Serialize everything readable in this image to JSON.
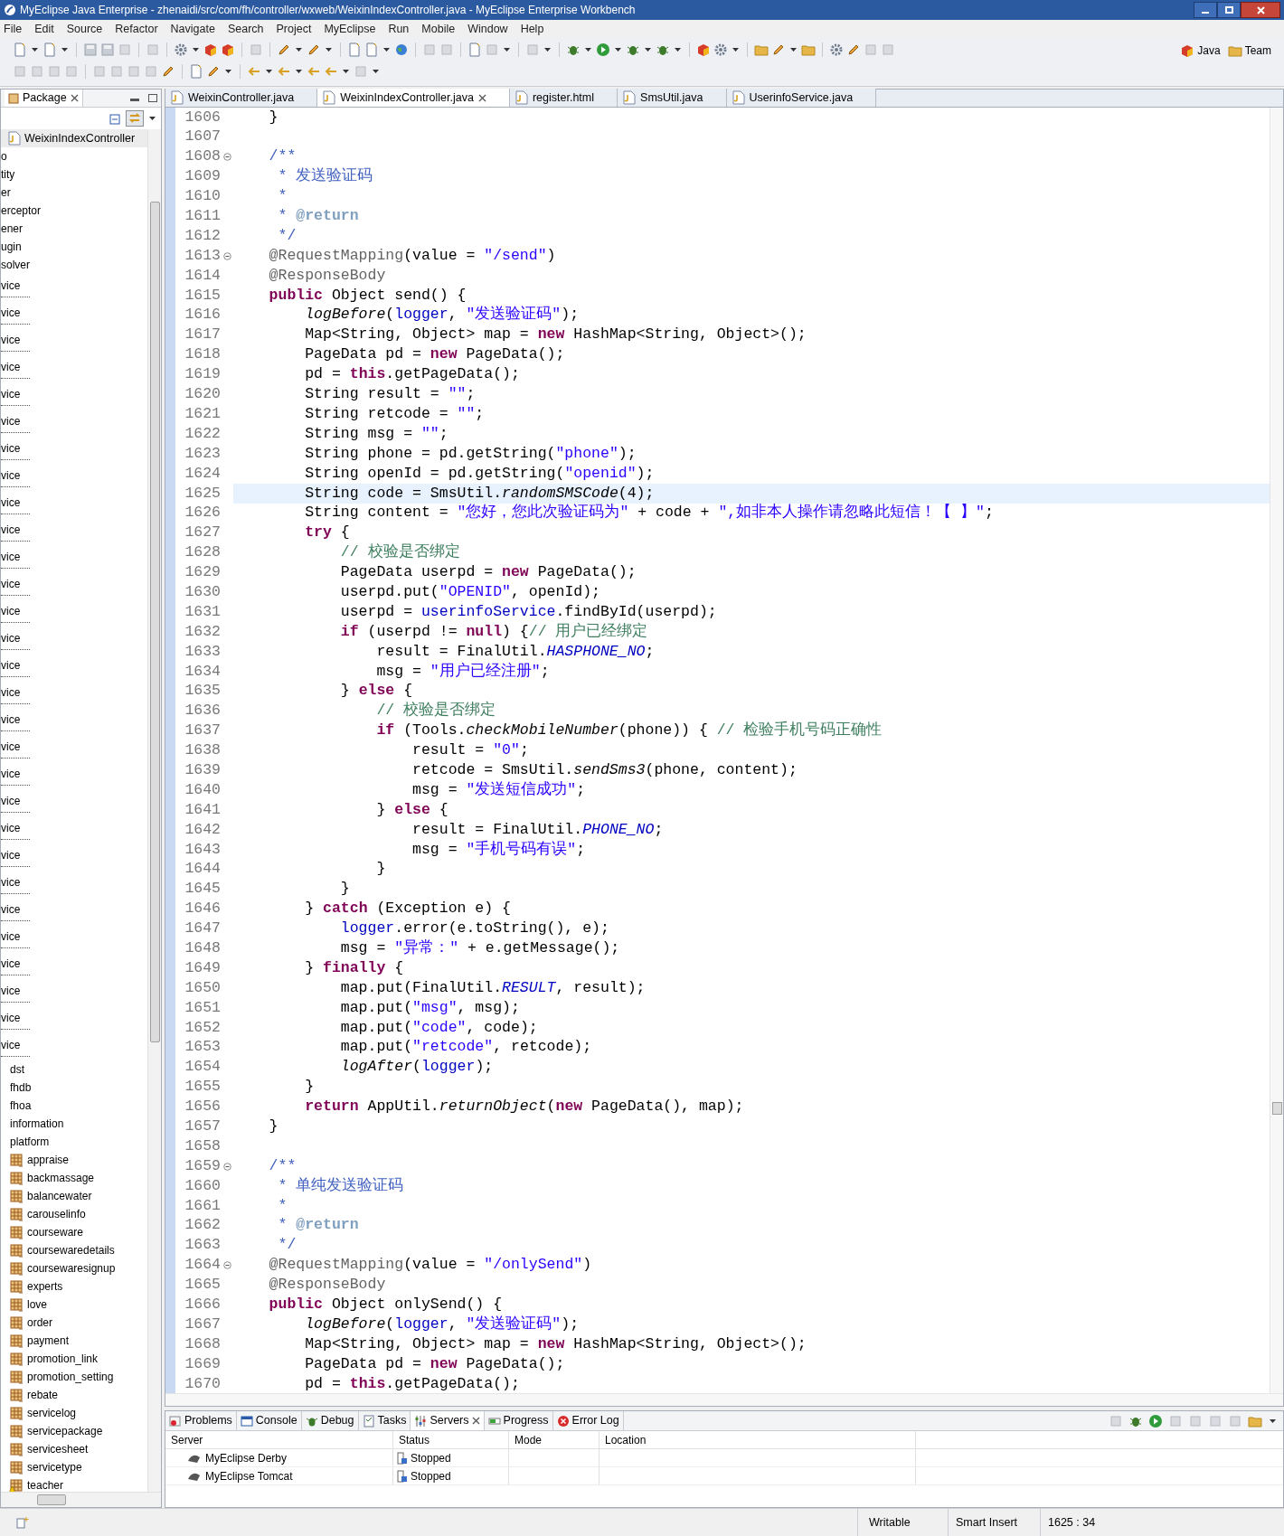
{
  "window": {
    "title": "MyEclipse Java Enterprise - zhenaidi/src/com/fh/controller/wxweb/WeixinIndexController.java - MyEclipse Enterprise Workbench"
  },
  "menu": [
    "File",
    "Edit",
    "Source",
    "Refactor",
    "Navigate",
    "Search",
    "Project",
    "MyEclipse",
    "Run",
    "Mobile",
    "Window",
    "Help"
  ],
  "perspectives": [
    "Java",
    "Team"
  ],
  "sidebar": {
    "tab": "Package",
    "breadcrumb": "WeixinIndexController",
    "items": [
      {
        "label": "o",
        "kind": "cut"
      },
      {
        "label": "tity",
        "kind": "cut"
      },
      {
        "label": "er",
        "kind": "cut"
      },
      {
        "label": "erceptor",
        "kind": "cut"
      },
      {
        "label": "ener",
        "kind": "cut"
      },
      {
        "label": "ugin",
        "kind": "cut"
      },
      {
        "label": "solver",
        "kind": "cut"
      },
      {
        "label": "vice",
        "kind": "dotted"
      },
      {
        "label": "vice",
        "kind": "dotted"
      },
      {
        "label": "vice",
        "kind": "dotted"
      },
      {
        "label": "vice",
        "kind": "dotted"
      },
      {
        "label": "vice",
        "kind": "dotted"
      },
      {
        "label": "vice",
        "kind": "dotted"
      },
      {
        "label": "vice",
        "kind": "dotted"
      },
      {
        "label": "vice",
        "kind": "dotted"
      },
      {
        "label": "vice",
        "kind": "dotted"
      },
      {
        "label": "vice",
        "kind": "dotted"
      },
      {
        "label": "vice",
        "kind": "dotted"
      },
      {
        "label": "vice",
        "kind": "dotted"
      },
      {
        "label": "vice",
        "kind": "dotted"
      },
      {
        "label": "vice",
        "kind": "dotted"
      },
      {
        "label": "vice",
        "kind": "dotted"
      },
      {
        "label": "vice",
        "kind": "dotted"
      },
      {
        "label": "vice",
        "kind": "dotted"
      },
      {
        "label": "vice",
        "kind": "dotted"
      },
      {
        "label": "vice",
        "kind": "dotted"
      },
      {
        "label": "vice",
        "kind": "dotted"
      },
      {
        "label": "vice",
        "kind": "dotted"
      },
      {
        "label": "vice",
        "kind": "dotted"
      },
      {
        "label": "vice",
        "kind": "dotted"
      },
      {
        "label": "vice",
        "kind": "dotted"
      },
      {
        "label": "vice",
        "kind": "dotted"
      },
      {
        "label": "vice",
        "kind": "dotted"
      },
      {
        "label": "vice",
        "kind": "dotted"
      },
      {
        "label": "vice",
        "kind": "dotted"
      },
      {
        "label": "vice",
        "kind": "dotted"
      },
      {
        "label": "dst",
        "kind": "plain"
      },
      {
        "label": "fhdb",
        "kind": "plain"
      },
      {
        "label": "fhoa",
        "kind": "plain"
      },
      {
        "label": "information",
        "kind": "plain"
      },
      {
        "label": "platform",
        "kind": "plain"
      },
      {
        "label": "appraise",
        "kind": "package",
        "warning": false
      },
      {
        "label": "backmassage",
        "kind": "package",
        "warning": false
      },
      {
        "label": "balancewater",
        "kind": "package",
        "warning": false
      },
      {
        "label": "carouselinfo",
        "kind": "package",
        "warning": false
      },
      {
        "label": "courseware",
        "kind": "package",
        "warning": false
      },
      {
        "label": "coursewaredetails",
        "kind": "package",
        "warning": false
      },
      {
        "label": "coursewaresignup",
        "kind": "package",
        "warning": false
      },
      {
        "label": "experts",
        "kind": "package",
        "warning": false
      },
      {
        "label": "love",
        "kind": "package",
        "warning": false
      },
      {
        "label": "order",
        "kind": "package",
        "warning": false
      },
      {
        "label": "payment",
        "kind": "package",
        "warning": false
      },
      {
        "label": "promotion_link",
        "kind": "package",
        "warning": false
      },
      {
        "label": "promotion_setting",
        "kind": "package",
        "warning": false
      },
      {
        "label": "rebate",
        "kind": "package",
        "warning": false
      },
      {
        "label": "servicelog",
        "kind": "package",
        "warning": false
      },
      {
        "label": "servicepackage",
        "kind": "package",
        "warning": false
      },
      {
        "label": "servicesheet",
        "kind": "package",
        "warning": false
      },
      {
        "label": "servicetype",
        "kind": "package",
        "warning": false
      },
      {
        "label": "teacher",
        "kind": "package",
        "warning": true
      }
    ]
  },
  "editor_tabs": [
    {
      "label": "WeixinController.java",
      "selected": false
    },
    {
      "label": "WeixinIndexController.java",
      "selected": true
    },
    {
      "label": "register.html",
      "selected": false
    },
    {
      "label": "SmsUtil.java",
      "selected": false
    },
    {
      "label": "UserinfoService.java",
      "selected": false
    }
  ],
  "code": [
    {
      "n": "1606",
      "t": [
        {
          "kind": "p",
          "text": "    }"
        }
      ]
    },
    {
      "n": "1607"
    },
    {
      "n": "1608",
      "fold": true,
      "t": [
        {
          "kind": "doc",
          "text": "    /**"
        }
      ]
    },
    {
      "n": "1609",
      "t": [
        {
          "kind": "doc",
          "text": "     * 发送验证码"
        }
      ]
    },
    {
      "n": "1610",
      "t": [
        {
          "kind": "doc",
          "text": "     *"
        }
      ]
    },
    {
      "n": "1611",
      "t": [
        {
          "kind": "doc",
          "text": "     * "
        },
        {
          "kind": "tag",
          "text": "@return"
        }
      ]
    },
    {
      "n": "1612",
      "t": [
        {
          "kind": "doc",
          "text": "     */"
        }
      ]
    },
    {
      "n": "1613",
      "fold": true,
      "t": [
        {
          "kind": "anno",
          "text": "    @RequestMapping"
        },
        {
          "kind": "p",
          "text": "(value = "
        },
        {
          "kind": "str",
          "text": "\"/send\""
        },
        {
          "kind": "p",
          "text": ")"
        }
      ]
    },
    {
      "n": "1614",
      "t": [
        {
          "kind": "anno",
          "text": "    @ResponseBody"
        }
      ]
    },
    {
      "n": "1615",
      "t": [
        {
          "kind": "kw",
          "text": "    public"
        },
        {
          "kind": "p",
          "text": " Object send() {"
        }
      ]
    },
    {
      "n": "1616",
      "t": [
        {
          "kind": "it",
          "text": "        logBefore"
        },
        {
          "kind": "p",
          "text": "("
        },
        {
          "kind": "fld",
          "text": "logger"
        },
        {
          "kind": "p",
          "text": ", "
        },
        {
          "kind": "str",
          "text": "\"发送验证码\""
        },
        {
          "kind": "p",
          "text": ");"
        }
      ]
    },
    {
      "n": "1617",
      "t": [
        {
          "kind": "p",
          "text": "        Map<String, Object> map = "
        },
        {
          "kind": "kw",
          "text": "new"
        },
        {
          "kind": "p",
          "text": " HashMap<String, Object>();"
        }
      ]
    },
    {
      "n": "1618",
      "t": [
        {
          "kind": "p",
          "text": "        PageData pd = "
        },
        {
          "kind": "kw",
          "text": "new"
        },
        {
          "kind": "p",
          "text": " PageData();"
        }
      ]
    },
    {
      "n": "1619",
      "t": [
        {
          "kind": "p",
          "text": "        pd = "
        },
        {
          "kind": "kw",
          "text": "this"
        },
        {
          "kind": "p",
          "text": ".getPageData();"
        }
      ]
    },
    {
      "n": "1620",
      "t": [
        {
          "kind": "p",
          "text": "        String result = "
        },
        {
          "kind": "str",
          "text": "\"\""
        },
        {
          "kind": "p",
          "text": ";"
        }
      ]
    },
    {
      "n": "1621",
      "t": [
        {
          "kind": "p",
          "text": "        String retcode = "
        },
        {
          "kind": "str",
          "text": "\"\""
        },
        {
          "kind": "p",
          "text": ";"
        }
      ]
    },
    {
      "n": "1622",
      "t": [
        {
          "kind": "p",
          "text": "        String msg = "
        },
        {
          "kind": "str",
          "text": "\"\""
        },
        {
          "kind": "p",
          "text": ";"
        }
      ]
    },
    {
      "n": "1623",
      "t": [
        {
          "kind": "p",
          "text": "        String phone = pd.getString("
        },
        {
          "kind": "str",
          "text": "\"phone\""
        },
        {
          "kind": "p",
          "text": ");"
        }
      ]
    },
    {
      "n": "1624",
      "t": [
        {
          "kind": "p",
          "text": "        String openId = pd.getString("
        },
        {
          "kind": "str",
          "text": "\"openid\""
        },
        {
          "kind": "p",
          "text": ");"
        }
      ]
    },
    {
      "n": "1625",
      "current": true,
      "t": [
        {
          "kind": "p",
          "text": "        String code = SmsUtil."
        },
        {
          "kind": "it",
          "text": "randomSMSCode"
        },
        {
          "kind": "p",
          "text": "(4);"
        }
      ]
    },
    {
      "n": "1626",
      "t": [
        {
          "kind": "p",
          "text": "        String content = "
        },
        {
          "kind": "str",
          "text": "\"您好，您此次验证码为\""
        },
        {
          "kind": "p",
          "text": " + code + "
        },
        {
          "kind": "str",
          "text": "\",如非本人操作请忽略此短信！【 】\""
        },
        {
          "kind": "p",
          "text": ";"
        }
      ]
    },
    {
      "n": "1627",
      "t": [
        {
          "kind": "kw",
          "text": "        try"
        },
        {
          "kind": "p",
          "text": " {"
        }
      ]
    },
    {
      "n": "1628",
      "t": [
        {
          "kind": "cmt",
          "text": "            // 校验是否绑定"
        }
      ]
    },
    {
      "n": "1629",
      "t": [
        {
          "kind": "p",
          "text": "            PageData userpd = "
        },
        {
          "kind": "kw",
          "text": "new"
        },
        {
          "kind": "p",
          "text": " PageData();"
        }
      ]
    },
    {
      "n": "1630",
      "t": [
        {
          "kind": "p",
          "text": "            userpd.put("
        },
        {
          "kind": "str",
          "text": "\"OPENID\""
        },
        {
          "kind": "p",
          "text": ", openId);"
        }
      ]
    },
    {
      "n": "1631",
      "t": [
        {
          "kind": "p",
          "text": "            userpd = "
        },
        {
          "kind": "fld",
          "text": "userinfoService"
        },
        {
          "kind": "p",
          "text": ".findById(userpd);"
        }
      ]
    },
    {
      "n": "1632",
      "t": [
        {
          "kind": "kw",
          "text": "            if"
        },
        {
          "kind": "p",
          "text": " (userpd != "
        },
        {
          "kind": "kw",
          "text": "null"
        },
        {
          "kind": "p",
          "text": ") {"
        },
        {
          "kind": "cmt",
          "text": "// 用户已经绑定"
        }
      ]
    },
    {
      "n": "1633",
      "t": [
        {
          "kind": "p",
          "text": "                result = FinalUtil."
        },
        {
          "kind": "const",
          "text": "HASPHONE_NO"
        },
        {
          "kind": "p",
          "text": ";"
        }
      ]
    },
    {
      "n": "1634",
      "t": [
        {
          "kind": "p",
          "text": "                msg = "
        },
        {
          "kind": "str",
          "text": "\"用户已经注册\""
        },
        {
          "kind": "p",
          "text": ";"
        }
      ]
    },
    {
      "n": "1635",
      "t": [
        {
          "kind": "p",
          "text": "            } "
        },
        {
          "kind": "kw",
          "text": "else"
        },
        {
          "kind": "p",
          "text": " {"
        }
      ]
    },
    {
      "n": "1636",
      "t": [
        {
          "kind": "cmt",
          "text": "                // 校验是否绑定"
        }
      ]
    },
    {
      "n": "1637",
      "t": [
        {
          "kind": "kw",
          "text": "                if"
        },
        {
          "kind": "p",
          "text": " (Tools."
        },
        {
          "kind": "it",
          "text": "checkMobileNumber"
        },
        {
          "kind": "p",
          "text": "(phone)) { "
        },
        {
          "kind": "cmt",
          "text": "// 检验手机号码正确性"
        }
      ]
    },
    {
      "n": "1638",
      "t": [
        {
          "kind": "p",
          "text": "                    result = "
        },
        {
          "kind": "str",
          "text": "\"0\""
        },
        {
          "kind": "p",
          "text": ";"
        }
      ]
    },
    {
      "n": "1639",
      "t": [
        {
          "kind": "p",
          "text": "                    retcode = SmsUtil."
        },
        {
          "kind": "it",
          "text": "sendSms3"
        },
        {
          "kind": "p",
          "text": "(phone, content);"
        }
      ]
    },
    {
      "n": "1640",
      "t": [
        {
          "kind": "p",
          "text": "                    msg = "
        },
        {
          "kind": "str",
          "text": "\"发送短信成功\""
        },
        {
          "kind": "p",
          "text": ";"
        }
      ]
    },
    {
      "n": "1641",
      "t": [
        {
          "kind": "p",
          "text": "                } "
        },
        {
          "kind": "kw",
          "text": "else"
        },
        {
          "kind": "p",
          "text": " {"
        }
      ]
    },
    {
      "n": "1642",
      "t": [
        {
          "kind": "p",
          "text": "                    result = FinalUtil."
        },
        {
          "kind": "const",
          "text": "PHONE_NO"
        },
        {
          "kind": "p",
          "text": ";"
        }
      ]
    },
    {
      "n": "1643",
      "t": [
        {
          "kind": "p",
          "text": "                    msg = "
        },
        {
          "kind": "str",
          "text": "\"手机号码有误\""
        },
        {
          "kind": "p",
          "text": ";"
        }
      ]
    },
    {
      "n": "1644",
      "t": [
        {
          "kind": "p",
          "text": "                }"
        }
      ]
    },
    {
      "n": "1645",
      "t": [
        {
          "kind": "p",
          "text": "            }"
        }
      ]
    },
    {
      "n": "1646",
      "t": [
        {
          "kind": "p",
          "text": "        } "
        },
        {
          "kind": "kw",
          "text": "catch"
        },
        {
          "kind": "p",
          "text": " (Exception e) {"
        }
      ]
    },
    {
      "n": "1647",
      "t": [
        {
          "kind": "fld",
          "text": "            logger"
        },
        {
          "kind": "p",
          "text": ".error(e.toString(), e);"
        }
      ]
    },
    {
      "n": "1648",
      "t": [
        {
          "kind": "p",
          "text": "            msg = "
        },
        {
          "kind": "str",
          "text": "\"异常：\""
        },
        {
          "kind": "p",
          "text": " + e.getMessage();"
        }
      ]
    },
    {
      "n": "1649",
      "t": [
        {
          "kind": "p",
          "text": "        } "
        },
        {
          "kind": "kw",
          "text": "finally"
        },
        {
          "kind": "p",
          "text": " {"
        }
      ]
    },
    {
      "n": "1650",
      "t": [
        {
          "kind": "p",
          "text": "            map.put(FinalUtil."
        },
        {
          "kind": "const",
          "text": "RESULT"
        },
        {
          "kind": "p",
          "text": ", result);"
        }
      ]
    },
    {
      "n": "1651",
      "t": [
        {
          "kind": "p",
          "text": "            map.put("
        },
        {
          "kind": "str",
          "text": "\"msg\""
        },
        {
          "kind": "p",
          "text": ", msg);"
        }
      ]
    },
    {
      "n": "1652",
      "t": [
        {
          "kind": "p",
          "text": "            map.put("
        },
        {
          "kind": "str",
          "text": "\"code\""
        },
        {
          "kind": "p",
          "text": ", code);"
        }
      ]
    },
    {
      "n": "1653",
      "t": [
        {
          "kind": "p",
          "text": "            map.put("
        },
        {
          "kind": "str",
          "text": "\"retcode\""
        },
        {
          "kind": "p",
          "text": ", retcode);"
        }
      ]
    },
    {
      "n": "1654",
      "t": [
        {
          "kind": "it",
          "text": "            logAfter"
        },
        {
          "kind": "p",
          "text": "("
        },
        {
          "kind": "fld",
          "text": "logger"
        },
        {
          "kind": "p",
          "text": ");"
        }
      ]
    },
    {
      "n": "1655",
      "t": [
        {
          "kind": "p",
          "text": "        }"
        }
      ]
    },
    {
      "n": "1656",
      "t": [
        {
          "kind": "kw",
          "text": "        return"
        },
        {
          "kind": "p",
          "text": " AppUtil."
        },
        {
          "kind": "it",
          "text": "returnObject"
        },
        {
          "kind": "p",
          "text": "("
        },
        {
          "kind": "kw",
          "text": "new"
        },
        {
          "kind": "p",
          "text": " PageData(), map);"
        }
      ]
    },
    {
      "n": "1657",
      "t": [
        {
          "kind": "p",
          "text": "    }"
        }
      ]
    },
    {
      "n": "1658"
    },
    {
      "n": "1659",
      "fold": true,
      "t": [
        {
          "kind": "doc",
          "text": "    /**"
        }
      ]
    },
    {
      "n": "1660",
      "t": [
        {
          "kind": "doc",
          "text": "     * 单纯发送验证码"
        }
      ]
    },
    {
      "n": "1661",
      "t": [
        {
          "kind": "doc",
          "text": "     *"
        }
      ]
    },
    {
      "n": "1662",
      "t": [
        {
          "kind": "doc",
          "text": "     * "
        },
        {
          "kind": "tag",
          "text": "@return"
        }
      ]
    },
    {
      "n": "1663",
      "t": [
        {
          "kind": "doc",
          "text": "     */"
        }
      ]
    },
    {
      "n": "1664",
      "fold": true,
      "t": [
        {
          "kind": "anno",
          "text": "    @RequestMapping"
        },
        {
          "kind": "p",
          "text": "(value = "
        },
        {
          "kind": "str",
          "text": "\"/onlySend\""
        },
        {
          "kind": "p",
          "text": ")"
        }
      ]
    },
    {
      "n": "1665",
      "t": [
        {
          "kind": "anno",
          "text": "    @ResponseBody"
        }
      ]
    },
    {
      "n": "1666",
      "t": [
        {
          "kind": "kw",
          "text": "    public"
        },
        {
          "kind": "p",
          "text": " Object onlySend() {"
        }
      ]
    },
    {
      "n": "1667",
      "t": [
        {
          "kind": "it",
          "text": "        logBefore"
        },
        {
          "kind": "p",
          "text": "("
        },
        {
          "kind": "fld",
          "text": "logger"
        },
        {
          "kind": "p",
          "text": ", "
        },
        {
          "kind": "str",
          "text": "\"发送验证码\""
        },
        {
          "kind": "p",
          "text": ");"
        }
      ]
    },
    {
      "n": "1668",
      "t": [
        {
          "kind": "p",
          "text": "        Map<String, Object> map = "
        },
        {
          "kind": "kw",
          "text": "new"
        },
        {
          "kind": "p",
          "text": " HashMap<String, Object>();"
        }
      ]
    },
    {
      "n": "1669",
      "t": [
        {
          "kind": "p",
          "text": "        PageData pd = "
        },
        {
          "kind": "kw",
          "text": "new"
        },
        {
          "kind": "p",
          "text": " PageData();"
        }
      ]
    },
    {
      "n": "1670",
      "t": [
        {
          "kind": "p",
          "text": "        pd = "
        },
        {
          "kind": "kw",
          "text": "this"
        },
        {
          "kind": "p",
          "text": ".getPageData();"
        }
      ]
    }
  ],
  "bottom_tabs": [
    {
      "label": "Problems",
      "selected": false
    },
    {
      "label": "Console",
      "selected": false
    },
    {
      "label": "Debug",
      "selected": false
    },
    {
      "label": "Tasks",
      "selected": false
    },
    {
      "label": "Servers",
      "selected": true
    },
    {
      "label": "Progress",
      "selected": false
    },
    {
      "label": "Error Log",
      "selected": false
    }
  ],
  "servers": {
    "columns": [
      "Server",
      "Status",
      "Mode",
      "Location"
    ],
    "rows": [
      {
        "server": "MyEclipse Derby",
        "status": "Stopped"
      },
      {
        "server": "MyEclipse Tomcat",
        "status": "Stopped"
      }
    ]
  },
  "status_bar": {
    "mode": "Writable",
    "insert": "Smart Insert",
    "position": "1625 : 34"
  }
}
